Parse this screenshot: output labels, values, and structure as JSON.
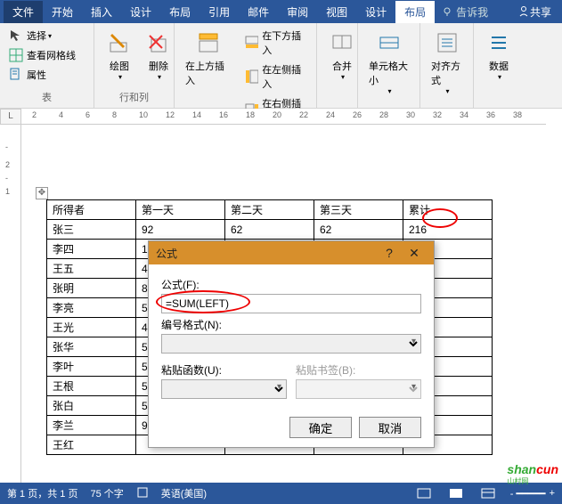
{
  "menubar": {
    "file": "文件",
    "tabs": [
      "开始",
      "插入",
      "设计",
      "布局",
      "引用",
      "邮件",
      "审阅",
      "视图",
      "设计",
      "布局"
    ],
    "tell": "告诉我",
    "share": "共享"
  },
  "ribbon": {
    "table": {
      "select": "选择",
      "gridlines": "查看网格线",
      "properties": "属性",
      "label": "表"
    },
    "drawing": {
      "draw": "绘图",
      "delete": "删除"
    },
    "rows": {
      "insertAbove": "在上方插入",
      "insertBelow": "在下方插入",
      "insertLeft": "在左侧插入",
      "insertRight": "在右侧插入",
      "label": "行和列"
    },
    "merge": "合并",
    "cellSize": "单元格大小",
    "align": "对齐方式",
    "data": "数据"
  },
  "ruler": {
    "corner": "L",
    "ticks": [
      "2",
      "4",
      "6",
      "8",
      "10",
      "12",
      "14",
      "16",
      "18",
      "20",
      "22",
      "24",
      "26",
      "28",
      "30",
      "32",
      "34",
      "36",
      "38"
    ]
  },
  "sheet": {
    "headers": [
      "所得者",
      "第一天",
      "第二天",
      "第三天",
      "累计"
    ],
    "rows": [
      [
        "张三",
        "92",
        "62",
        "62",
        "216"
      ],
      [
        "李四",
        "1",
        "",
        "",
        ""
      ],
      [
        "王五",
        "4",
        "",
        "",
        ""
      ],
      [
        "张明",
        "8",
        "",
        "",
        ""
      ],
      [
        "李亮",
        "5",
        "",
        "",
        ""
      ],
      [
        "王光",
        "4",
        "",
        "",
        ""
      ],
      [
        "张华",
        "5",
        "",
        "",
        ""
      ],
      [
        "李叶",
        "5",
        "",
        "",
        ""
      ],
      [
        "王根",
        "5",
        "",
        "",
        ""
      ],
      [
        "张白",
        "5",
        "",
        "",
        ""
      ],
      [
        "李兰",
        "9",
        "",
        "",
        ""
      ],
      [
        "王红",
        "",
        "",
        "",
        ""
      ]
    ]
  },
  "dialog": {
    "title": "公式",
    "formula_label": "公式(F):",
    "formula_value": "=SUM(LEFT)",
    "format_label": "编号格式(N):",
    "format_value": "",
    "paste_func_label": "粘贴函数(U):",
    "paste_bookmark_label": "粘贴书签(B):",
    "ok": "确定",
    "cancel": "取消"
  },
  "status": {
    "page": "第 1 页，共 1 页",
    "words": "75 个字",
    "lang": "英语(美国)",
    "zoom": "+"
  },
  "watermark": {
    "a": "shan",
    "b": "cun",
    "sub": "山村网"
  }
}
